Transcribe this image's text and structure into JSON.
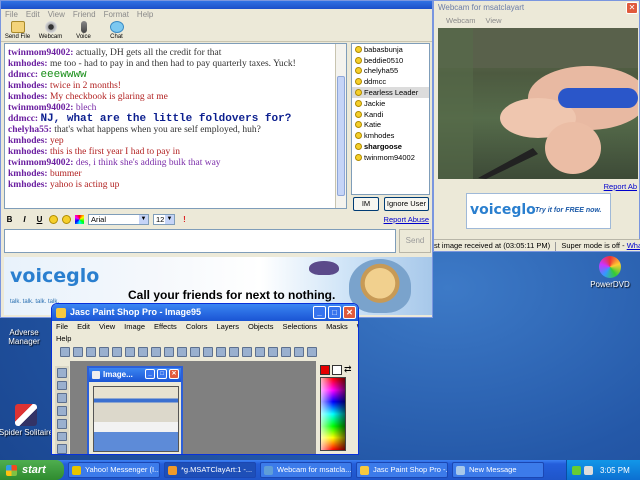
{
  "colors": {
    "accent": "#245edb",
    "chat_name": "#6b1fa0",
    "link": "#0000cc"
  },
  "desktop": {
    "icons": [
      {
        "label": "Adverse Manager"
      },
      {
        "label": "Spider Solitaire"
      },
      {
        "label": "PowerDVD"
      }
    ]
  },
  "yahoo": {
    "menu": [
      "File",
      "Edit",
      "View",
      "Friend",
      "Format",
      "Help"
    ],
    "toolbar": [
      {
        "label": "Send File",
        "icon": "send-file-icon"
      },
      {
        "label": "Webcam",
        "icon": "webcam-icon"
      },
      {
        "label": "Voice",
        "icon": "voice-icon"
      },
      {
        "label": "Chat",
        "icon": "chat-icon"
      }
    ],
    "messages": [
      {
        "who": "twinmom94002:",
        "text": "actually, DH gets all the credit for that",
        "style": "txt-gray"
      },
      {
        "who": "kmhodes:",
        "text": "me too - had to pay in and then had to pay quarterly taxes. Yuck!",
        "style": "txt-gray"
      },
      {
        "who": "ddmcc:",
        "text": "eeewwww",
        "style": "txt-green"
      },
      {
        "who": "kmhodes:",
        "text": "twice in 2 months!",
        "style": "txt-red"
      },
      {
        "who": "kmhodes:",
        "text": "My checkbook is glaring at me",
        "style": "txt-red"
      },
      {
        "who": "twinmom94002:",
        "text": "blech",
        "style": "txt-purple"
      },
      {
        "who": "ddmcc:",
        "text": "NJ, what are the little foldovers for?",
        "style": "txt-blue"
      },
      {
        "who": "chelyha55:",
        "text": "that's what happens when you are self employed, huh?",
        "style": "txt-gray"
      },
      {
        "who": "kmhodes:",
        "text": "yep",
        "style": "txt-red"
      },
      {
        "who": "kmhodes:",
        "text": "this is the first year I had to pay in",
        "style": "txt-red"
      },
      {
        "who": "twinmom94002:",
        "text": "des, i think she's adding bulk that way",
        "style": "txt-purple"
      },
      {
        "who": "kmhodes:",
        "text": "bummer",
        "style": "txt-red"
      },
      {
        "who": "kmhodes:",
        "text": "yahoo is acting up",
        "style": "txt-red"
      }
    ],
    "buddies": [
      {
        "name": "babasbunja",
        "selected": false,
        "bold": false
      },
      {
        "name": "beddie0510",
        "selected": false,
        "bold": false
      },
      {
        "name": "chelyha55",
        "selected": false,
        "bold": false
      },
      {
        "name": "ddmcc",
        "selected": false,
        "bold": false
      },
      {
        "name": "Fearless Leader",
        "selected": true,
        "bold": false
      },
      {
        "name": "Jackie",
        "selected": false,
        "bold": false
      },
      {
        "name": "Kandi",
        "selected": false,
        "bold": false
      },
      {
        "name": "Katie",
        "selected": false,
        "bold": false
      },
      {
        "name": "kmhodes",
        "selected": false,
        "bold": false
      },
      {
        "name": "shargoose",
        "selected": false,
        "bold": true
      },
      {
        "name": "twinmom94002",
        "selected": false,
        "bold": false
      }
    ],
    "im_button": "IM",
    "ignore_button": "Ignore User",
    "format": {
      "bold": "B",
      "italic": "I",
      "underline": "U",
      "font": "Arial",
      "size": "12"
    },
    "report_abuse": "Report Abuse",
    "send_button": "Send",
    "ad": {
      "logo": "voiceglo",
      "tagline": "talk. talk. talk. talk.",
      "headline": "Call your friends for next to nothing."
    }
  },
  "webcam": {
    "title": "Webcam for msatclayart",
    "menu": [
      "Webcam",
      "View"
    ],
    "report_abuse": "Report Ab",
    "ad": {
      "logo": "voiceglo",
      "cta": "Try it for FREE now."
    },
    "status_received": "st image received at (03:05:11 PM)",
    "status_super": "Super mode is off -",
    "status_link": "What's th"
  },
  "psp": {
    "title": "Jasc Paint Shop Pro - Image95",
    "menu": [
      "File",
      "Edit",
      "View",
      "Image",
      "Effects",
      "Colors",
      "Layers",
      "Objects",
      "Selections",
      "Masks",
      "Window"
    ],
    "menu2": "Help",
    "image_window_title": "Image...",
    "swap_arrows": "⇄"
  },
  "taskbar": {
    "start": "start",
    "tasks": [
      {
        "label": "Yahoo! Messenger (I...",
        "icon_color": "#e8c400",
        "active": false
      },
      {
        "label": "*g.MSATClayArt:1 -...",
        "icon_color": "#f19a2a",
        "active": true
      },
      {
        "label": "Webcam for msatcla...",
        "icon_color": "#5f9ed8",
        "active": false
      },
      {
        "label": "Jasc Paint Shop Pro -...",
        "icon_color": "#f7c93e",
        "active": false
      },
      {
        "label": "New Message",
        "icon_color": "#a7c8ea",
        "active": false
      }
    ],
    "clock": "3:05 PM"
  }
}
